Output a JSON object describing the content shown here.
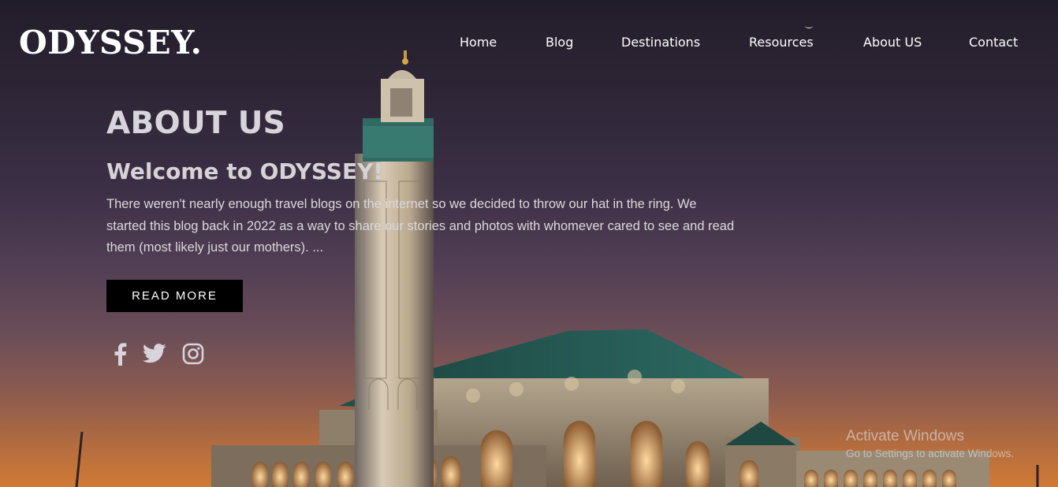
{
  "brand": {
    "logo": "ODYSSEY."
  },
  "nav": {
    "items": [
      {
        "label": "Home"
      },
      {
        "label": "Blog"
      },
      {
        "label": "Destinations"
      },
      {
        "label": "Resources"
      },
      {
        "label": "About US"
      },
      {
        "label": "Contact"
      }
    ]
  },
  "hero": {
    "heading": "ABOUT US",
    "subheading": "Welcome to ODYSSEY!",
    "paragraph": "There weren't nearly enough travel blogs on the internet so we decided to throw our hat in the ring. We started this blog back in 2022 as a way to share our stories and photos with whomever cared to see and read them (most likely just our mothers). ...",
    "cta_label": "READ MORE"
  },
  "socials": [
    "facebook-icon",
    "twitter-icon",
    "instagram-icon"
  ],
  "watermark": {
    "line1": "Activate Windows",
    "line2": "Go to Settings to activate Windows."
  },
  "colors": {
    "sky_top": "#221d2b",
    "sky_bottom": "#d07a35",
    "button_bg": "#000000",
    "text": "#ffffff"
  }
}
